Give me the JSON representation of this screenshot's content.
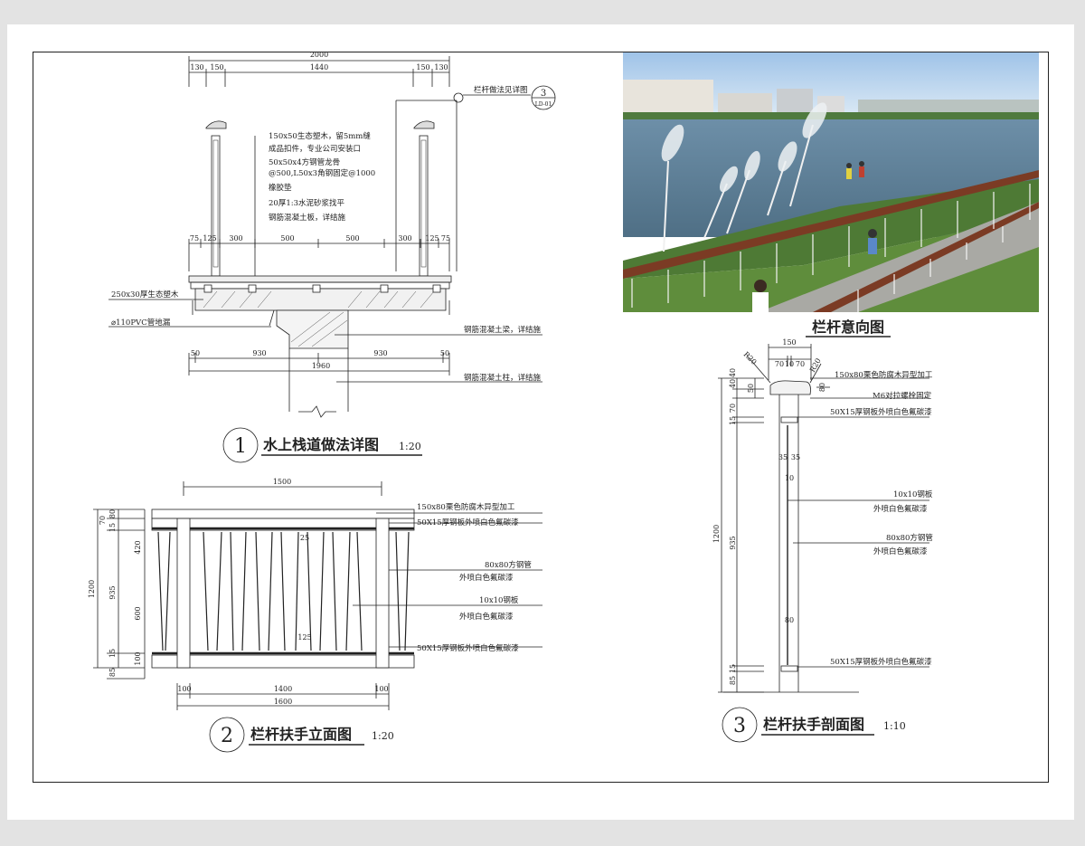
{
  "detail1": {
    "dims_top": [
      "2000",
      "130",
      "150",
      "1440",
      "150",
      "130"
    ],
    "dims_mid": [
      "75",
      "125",
      "300",
      "500",
      "500",
      "300",
      "125",
      "75"
    ],
    "dims_bottom": [
      "50",
      "930",
      "930",
      "50",
      "1960"
    ],
    "ref_note": "栏杆做法见详图",
    "ref_num": "3",
    "ref_sheet": "LD-01",
    "notes": [
      "150x50生态塑木，留5mm缝",
      "成品扣件，专业公司安装口",
      "50x50x4方钢管龙骨",
      "@500,L50x3角钢固定@1000",
      "橡胶垫",
      "20厚1:3水泥砂浆找平",
      "钢筋混凝土板，详结施"
    ],
    "left_notes": [
      "250x30厚生态塑木",
      "⌀110PVC管地漏"
    ],
    "right_notes": [
      "钢筋混凝土梁，详结施",
      "钢筋混凝土柱，详结施"
    ],
    "title_num": "1",
    "title": "水上栈道做法详图",
    "scale": "1:20"
  },
  "photo": {
    "caption": "栏杆意向图"
  },
  "detail2": {
    "dims_top": [
      "1500"
    ],
    "dims_left": [
      "1200",
      "70",
      "15",
      "80",
      "420",
      "935",
      "600",
      "100",
      "15",
      "85"
    ],
    "dims_inner": [
      "25",
      "125"
    ],
    "dims_bottom": [
      "100",
      "1400",
      "100",
      "1600"
    ],
    "notes": [
      "150x80栗色防腐木异型加工",
      "50X15厚钢板外喷白色氟碳漆",
      "80x80方钢管",
      "外喷白色氟碳漆",
      "10x10钢板",
      "外喷白色氟碳漆",
      "50X15厚钢板外喷白色氟碳漆"
    ],
    "title_num": "2",
    "title": "栏杆扶手立面图",
    "scale": "1:20"
  },
  "detail3": {
    "dims_top": [
      "150",
      "70",
      "10",
      "70"
    ],
    "radius": [
      "R20",
      "R20"
    ],
    "dims_left": [
      "40",
      "40",
      "50",
      "70",
      "15",
      "1200",
      "935",
      "15",
      "85"
    ],
    "dims_inner": [
      "35",
      "35",
      "10",
      "80"
    ],
    "dims_side": [
      "80"
    ],
    "notes": [
      "150x80栗色防腐木异型加工",
      "M6对拉螺栓固定",
      "50X15厚钢板外喷白色氟碳漆",
      "10x10钢板",
      "外喷白色氟碳漆",
      "80x80方钢管",
      "外喷白色氟碳漆",
      "50X15厚钢板外喷白色氟碳漆"
    ],
    "title_num": "3",
    "title": "栏杆扶手剖面图",
    "scale": "1:10"
  }
}
